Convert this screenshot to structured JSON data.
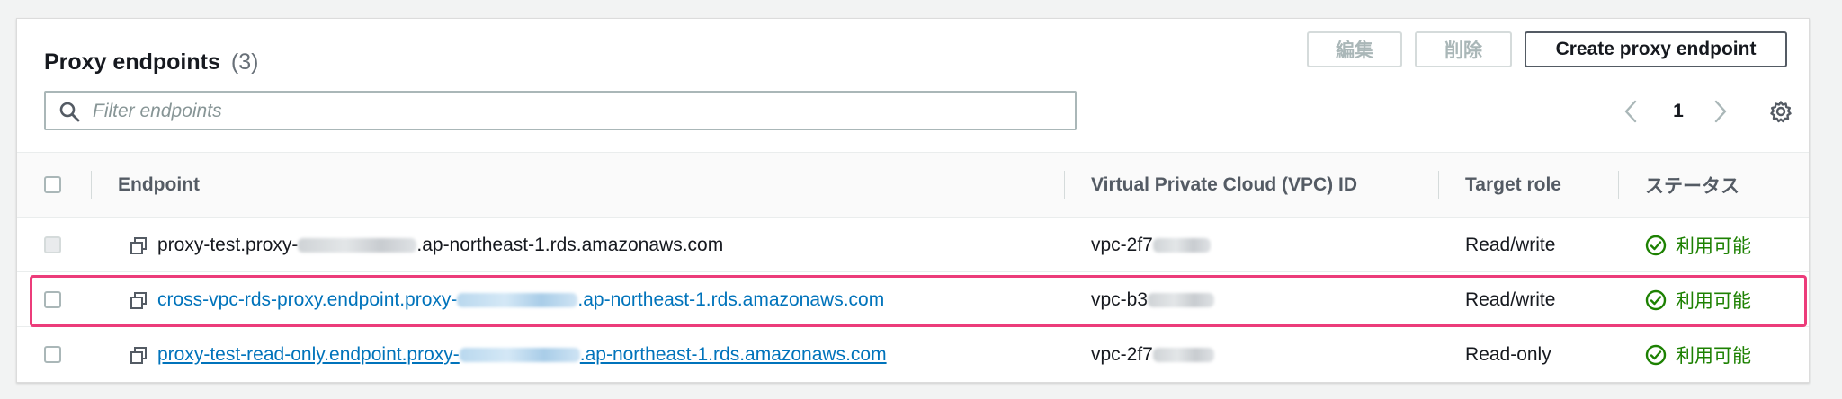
{
  "header": {
    "title": "Proxy endpoints",
    "count": "(3)",
    "edit_label": "編集",
    "delete_label": "削除",
    "create_label": "Create proxy endpoint"
  },
  "search": {
    "placeholder": "Filter endpoints"
  },
  "pagination": {
    "current_page": "1"
  },
  "table": {
    "columns": [
      "Endpoint",
      "Virtual Private Cloud (VPC) ID",
      "Target role",
      "ステータス"
    ],
    "rows": [
      {
        "endpoint_prefix": "proxy-test.proxy-",
        "endpoint_suffix": ".ap-northeast-1.rds.amazonaws.com",
        "vpc_prefix": "vpc-2f7",
        "role": "Read/write",
        "status": "利用可能"
      },
      {
        "endpoint_prefix": "cross-vpc-rds-proxy.endpoint.proxy-",
        "endpoint_suffix": ".ap-northeast-1.rds.amazonaws.com",
        "vpc_prefix": "vpc-b3",
        "role": "Read/write",
        "status": "利用可能"
      },
      {
        "endpoint_prefix": "proxy-test-read-only.endpoint.proxy-",
        "endpoint_suffix": ".ap-northeast-1.rds.amazonaws.com",
        "vpc_prefix": "vpc-2f7",
        "role": "Read-only",
        "status": "利用可能"
      }
    ]
  },
  "colors": {
    "link": "#0073bb",
    "success": "#1d8102",
    "highlight": "#ec3c7a"
  },
  "icons": [
    "search-icon",
    "chevron-left-icon",
    "chevron-right-icon",
    "gear-icon",
    "copy-icon",
    "status-available-icon"
  ]
}
